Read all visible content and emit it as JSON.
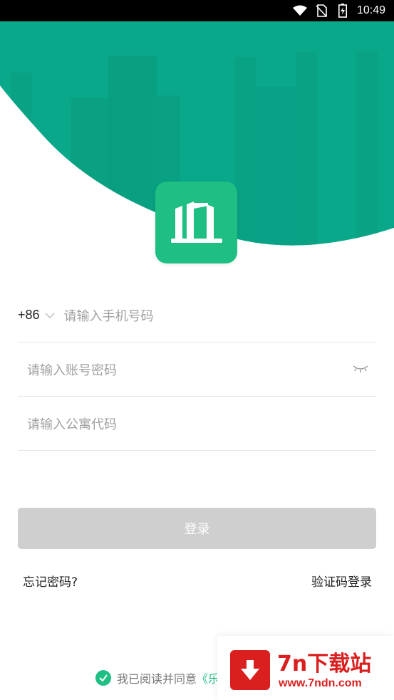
{
  "status_bar": {
    "time": "10:49"
  },
  "phone": {
    "country_code": "+86",
    "placeholder": "请输入手机号码"
  },
  "password": {
    "placeholder": "请输入账号密码"
  },
  "apartment": {
    "placeholder": "请输入公寓代码"
  },
  "login": {
    "label": "登录"
  },
  "links": {
    "forgot": "忘记密码?",
    "sms_login": "验证码登录"
  },
  "agreement": {
    "prefix": "我已阅读并同意",
    "link": "《乐"
  },
  "watermark": {
    "title": "7n下载站",
    "url": "www.7ndn.com"
  },
  "colors": {
    "brand": "#1fbf83",
    "hero": "#0aa88a",
    "button_disabled": "#cfcfcf",
    "watermark": "#d9201f"
  },
  "icons": [
    "wifi-icon",
    "no-sim-icon",
    "battery-icon",
    "building-logo-icon",
    "chevron-down-icon",
    "eye-closed-icon",
    "check-icon",
    "download-icon"
  ]
}
